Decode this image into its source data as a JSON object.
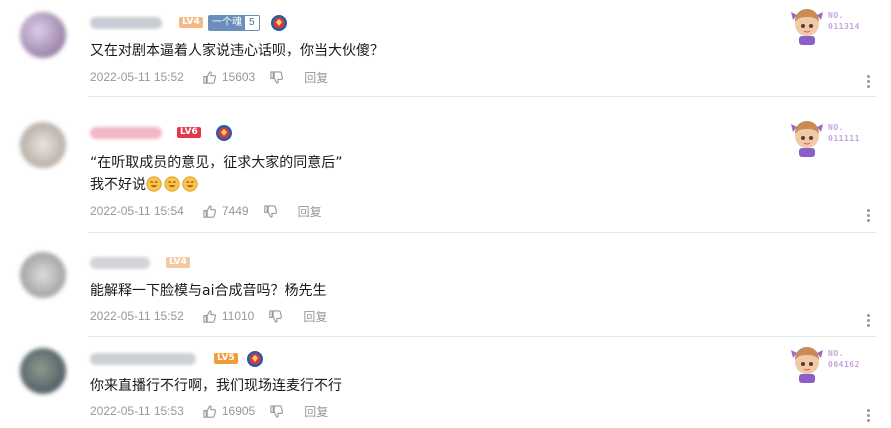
{
  "comments": [
    {
      "level": "LV4",
      "level_color": "#f5a06b",
      "badge_name": "一个魂",
      "badge_num": "5",
      "text": "又在对剧本逼着人家说违心话呗，你当大伙傻？",
      "time": "2022-05-11 15:52",
      "likes": "15603",
      "reply": "回复",
      "fan_no": "NO.\n011314"
    },
    {
      "level": "LV6",
      "level_color": "#e2384b",
      "text_line1": "“在听取成员的意见，征求大家的同意后”",
      "text_line2": "我不好说",
      "time": "2022-05-11 15:54",
      "likes": "7449",
      "reply": "回复",
      "fan_no": "NO.\n011111"
    },
    {
      "level": "LV4",
      "level_color": "#f5b883",
      "text": "能解释一下脸模与ai合成音吗？杨先生",
      "time": "2022-05-11 15:52",
      "likes": "11010",
      "reply": "回复"
    },
    {
      "level": "LV5",
      "level_color": "#f39a3c",
      "text": "你来直播行不行啊，我们现场连麦行不行",
      "time": "2022-05-11 15:53",
      "likes": "16905",
      "reply": "回复",
      "fan_no": "NO.\n004162"
    }
  ]
}
